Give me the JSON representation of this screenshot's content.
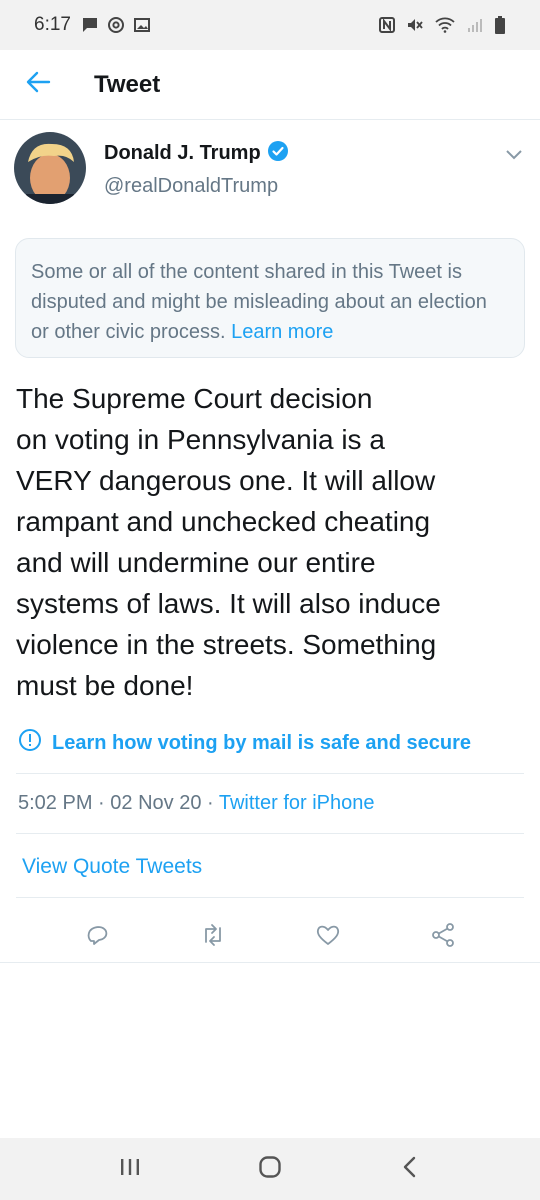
{
  "status_bar": {
    "time": "6:17",
    "left_icons": [
      "chat-notification-icon",
      "at-sign-icon",
      "image-icon"
    ],
    "right_icons": [
      "nfc-icon",
      "mute-icon",
      "wifi-icon",
      "signal-icon",
      "battery-icon"
    ]
  },
  "header": {
    "title": "Tweet",
    "back_icon": "back-arrow-icon"
  },
  "tweet": {
    "author_name": "Donald J. Trump",
    "verified": true,
    "handle": "@realDonaldTrump",
    "notice": {
      "text": "Some or all of the content shared in this Tweet is disputed and might be misleading about an election or other civic process.",
      "link": "Learn more"
    },
    "body_lines": [
      "The Supreme Court decision",
      "on voting in Pennsylvania is a",
      "VERY dangerous one. It will allow",
      "rampant and unchecked cheating",
      "and will undermine our entire",
      "systems of laws. It will also induce",
      "violence in the streets. Something",
      "must be done!"
    ],
    "voting_link": "Learn how voting by mail is safe and secure",
    "time": "5:02 PM",
    "date": "02 Nov 20",
    "separator": "·",
    "client": "Twitter for iPhone",
    "quote_link": "View Quote Tweets"
  },
  "actions": [
    "reply-icon",
    "retweet-icon",
    "like-icon",
    "share-icon"
  ],
  "nav": [
    "recent-apps-icon",
    "home-icon",
    "back-icon"
  ],
  "colors": {
    "accent": "#1da1f2",
    "secondary_text": "#657786",
    "primary_text": "#14171a",
    "notice_bg": "#f5f8fa",
    "system_bar_bg": "#f2f2f2",
    "icon_gray": "#8899a6"
  }
}
